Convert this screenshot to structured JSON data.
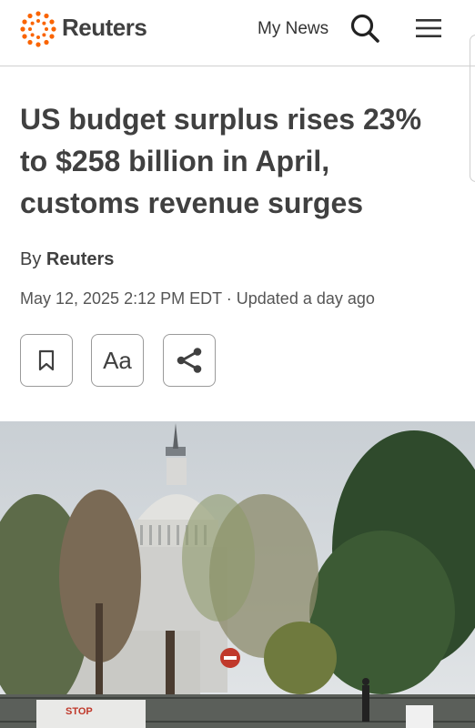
{
  "header": {
    "brand": "Reuters",
    "my_news": "My News",
    "brand_color": "#FA6400"
  },
  "article": {
    "headline": "US budget surplus rises 23% to $258 billion in April, customs revenue surges",
    "byline_prefix": "By",
    "author": "Reuters",
    "dateline": "May 12, 2025 2:12 PM EDT · Updated a day ago",
    "text_size_label": "Aa"
  },
  "photo": {
    "sign_text": "STOP"
  },
  "icons": {
    "logo": "reuters-logo-icon",
    "search": "search-icon",
    "menu": "hamburger-menu-icon",
    "bookmark": "bookmark-icon",
    "share": "share-icon"
  }
}
